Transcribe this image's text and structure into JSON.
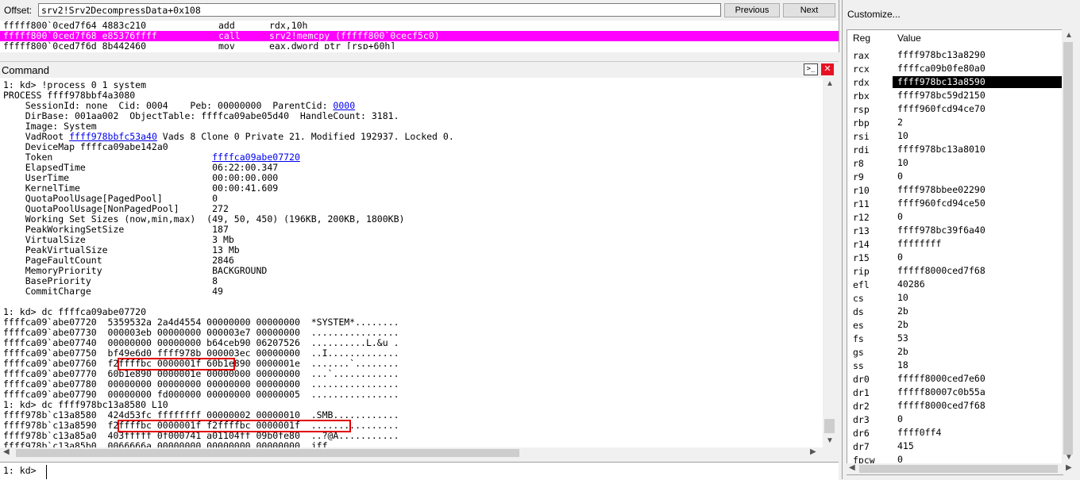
{
  "disasm": {
    "offset_label": "Offset:",
    "offset_value": "srv2!Srv2DecompressData+0x108",
    "previous_label": "Previous",
    "next_label": "Next",
    "lines": [
      {
        "addr": "fffff800`0ced7f64 4883c210",
        "mnem": "add",
        "ops": "rdx,10h",
        "highlight": false
      },
      {
        "addr": "fffff800`0ced7f68 e85376ffff",
        "mnem": "call",
        "ops": "srv2!memcpy (fffff800`0cecf5c0)",
        "highlight": true
      },
      {
        "addr": "fffff800`0ced7f6d 8b442460",
        "mnem": "mov",
        "ops": "eax,dword ptr [rsp+60h]",
        "highlight": false
      }
    ]
  },
  "command": {
    "title": "Command",
    "close_icon": "close-icon",
    "lines": [
      "1: kd> !process 0 1 system",
      "PROCESS ffff978bbf4a3080",
      "    SessionId: none  Cid: 0004    Peb: 00000000  ParentCid: 0000",
      "    DirBase: 001aa002  ObjectTable: ffffca09abe05d40  HandleCount: 3181.",
      "    Image: System",
      "    VadRoot ffff978bbfc53a40 Vads 8 Clone 0 Private 21. Modified 192937. Locked 0.",
      "    DeviceMap ffffca09abe142a0",
      "    Token                             ffffca09abe07720",
      "    ElapsedTime                       06:22:00.347",
      "    UserTime                          00:00:00.000",
      "    KernelTime                        00:00:41.609",
      "    QuotaPoolUsage[PagedPool]         0",
      "    QuotaPoolUsage[NonPagedPool]      272",
      "    Working Set Sizes (now,min,max)  (49, 50, 450) (196KB, 200KB, 1800KB)",
      "    PeakWorkingSetSize                187",
      "    VirtualSize                       3 Mb",
      "    PeakVirtualSize                   13 Mb",
      "    PageFaultCount                    2846",
      "    MemoryPriority                    BACKGROUND",
      "    BasePriority                      8",
      "    CommitCharge                      49",
      "",
      "1: kd> dc ffffca09abe07720",
      "ffffca09`abe07720  5359532a 2a4d4554 00000000 00000000  *SYSTEM*........",
      "ffffca09`abe07730  000003eb 00000000 000003e7 00000000  ................",
      "ffffca09`abe07740  00000000 00000000 b64ceb90 06207526  ..........L.&u .",
      "ffffca09`abe07750  bf49e6d0 ffff978b 000003ec 00000000  ..I.............",
      "ffffca09`abe07760  f2ffffbc 0000001f 60b1e890 0000001e  .......`........",
      "ffffca09`abe07770  60b1e890 0000001e 00000000 00000000  ...`............",
      "ffffca09`abe07780  00000000 00000000 00000000 00000000  ................",
      "ffffca09`abe07790  00000000 fd000000 00000000 00000005  ................",
      "1: kd> dc ffff978bc13a8580 L10",
      "ffff978b`c13a8580  424d53fc ffffffff 00000002 00000010  .SMB............",
      "ffff978b`c13a8590  f2ffffbc 0000001f f2ffffbc 0000001f  ................",
      "ffff978b`c13a85a0  403fffff 0f000741 a01104ff 09b0fe80  ..?@A...........",
      "ffff978b`c13a85b0  0066666a 00000000 00000000 00000000  jff............."
    ],
    "links": {
      "peb": "00000000",
      "parent_cid": "0000",
      "vadroot": "ffff978bbfc53a40",
      "token": "ffffca09abe07720"
    },
    "prompt_label": "1: kd>",
    "prompt_value": ""
  },
  "registers": {
    "customize_label": "Customize...",
    "col_reg": "Reg",
    "col_value": "Value",
    "selected": "rdx",
    "rows": [
      {
        "name": "rax",
        "value": "ffff978bc13a8290"
      },
      {
        "name": "rcx",
        "value": "ffffca09b0fe80a0"
      },
      {
        "name": "rdx",
        "value": "ffff978bc13a8590"
      },
      {
        "name": "rbx",
        "value": "ffff978bc59d2150"
      },
      {
        "name": "rsp",
        "value": "ffff960fcd94ce70"
      },
      {
        "name": "rbp",
        "value": "2"
      },
      {
        "name": "rsi",
        "value": "10"
      },
      {
        "name": "rdi",
        "value": "ffff978bc13a8010"
      },
      {
        "name": "r8",
        "value": "10"
      },
      {
        "name": "r9",
        "value": "0"
      },
      {
        "name": "r10",
        "value": "ffff978bbee02290"
      },
      {
        "name": "r11",
        "value": "ffff960fcd94ce50"
      },
      {
        "name": "r12",
        "value": "0"
      },
      {
        "name": "r13",
        "value": "ffff978bc39f6a40"
      },
      {
        "name": "r14",
        "value": "ffffffff"
      },
      {
        "name": "r15",
        "value": "0"
      },
      {
        "name": "rip",
        "value": "fffff8000ced7f68"
      },
      {
        "name": "efl",
        "value": "40286"
      },
      {
        "name": "cs",
        "value": "10"
      },
      {
        "name": "ds",
        "value": "2b"
      },
      {
        "name": "es",
        "value": "2b"
      },
      {
        "name": "fs",
        "value": "53"
      },
      {
        "name": "gs",
        "value": "2b"
      },
      {
        "name": "ss",
        "value": "18"
      },
      {
        "name": "dr0",
        "value": "fffff8000ced7e60"
      },
      {
        "name": "dr1",
        "value": "fffff80007c0b55a"
      },
      {
        "name": "dr2",
        "value": "fffff8000ced7f68"
      },
      {
        "name": "dr3",
        "value": "0"
      },
      {
        "name": "dr6",
        "value": "ffff0ff4"
      },
      {
        "name": "dr7",
        "value": "415"
      },
      {
        "name": "fpcw",
        "value": "0"
      }
    ]
  }
}
